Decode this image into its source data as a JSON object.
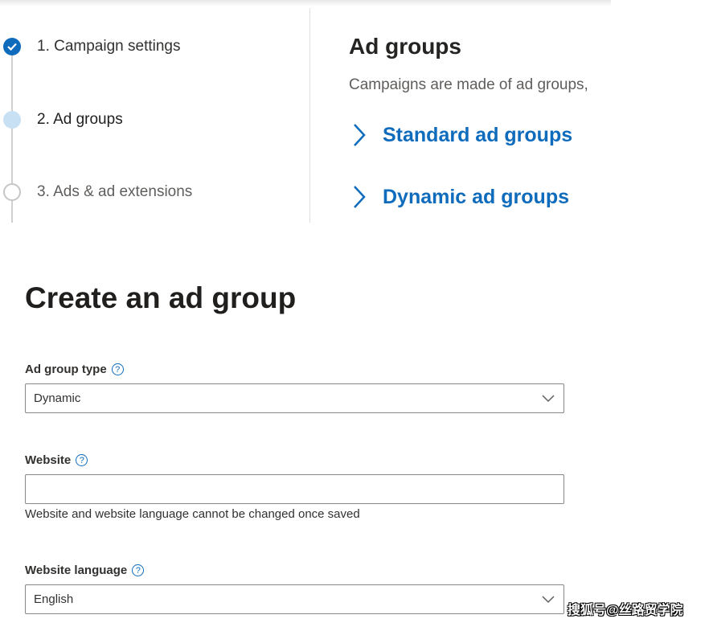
{
  "steps": [
    {
      "label": "1. Campaign settings",
      "state": "done"
    },
    {
      "label": "2. Ad groups",
      "state": "current"
    },
    {
      "label": "3. Ads & ad extensions",
      "state": "todo"
    }
  ],
  "ad_groups_panel": {
    "title": "Ad groups",
    "description": "Campaigns are made of ad groups,",
    "links": [
      "Standard ad groups",
      "Dynamic ad groups"
    ]
  },
  "form": {
    "heading": "Create an ad group",
    "ad_group_type": {
      "label": "Ad group type",
      "value": "Dynamic"
    },
    "website": {
      "label": "Website",
      "value": "",
      "hint": "Website and website language cannot be changed once saved"
    },
    "website_language": {
      "label": "Website language",
      "value": "English"
    },
    "help_glyph": "?"
  },
  "watermark": "搜狐号@丝路贸学院",
  "colors": {
    "accent": "#0f6cbd",
    "current_step": "#c7e0f4"
  }
}
